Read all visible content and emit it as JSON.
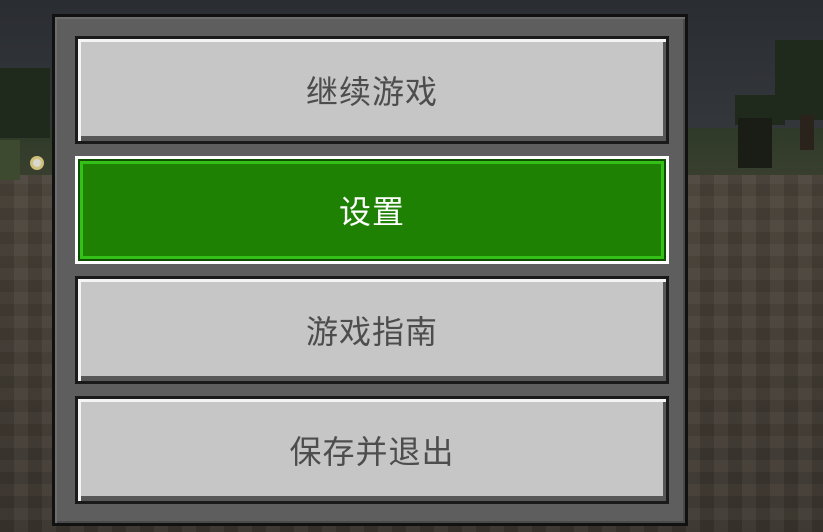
{
  "menu": {
    "buttons": [
      {
        "label": "继续游戏",
        "selected": false
      },
      {
        "label": "设置",
        "selected": true
      },
      {
        "label": "游戏指南",
        "selected": false
      },
      {
        "label": "保存并退出",
        "selected": false
      }
    ]
  },
  "colors": {
    "button_face": "#c6c6c6",
    "button_selected": "#1e8104",
    "panel": "#5e5e5e",
    "label_text": "#4d4d4d",
    "label_selected_text": "#ffffff"
  }
}
